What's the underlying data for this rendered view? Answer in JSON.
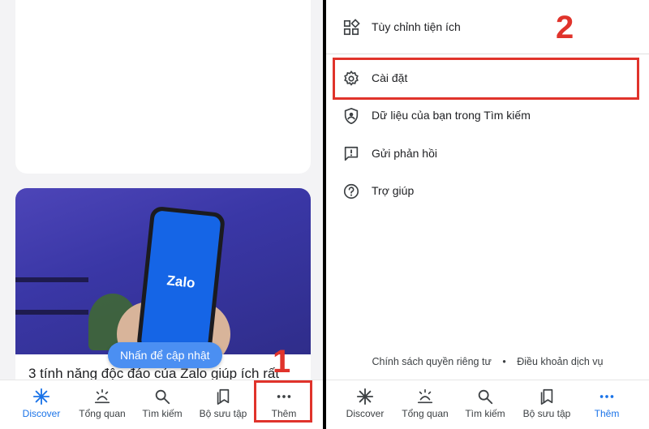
{
  "left": {
    "update_button": "Nhấn để cập nhật",
    "article_title": "3 tính năng độc đáo của Zalo giúp ích rất",
    "phone_brand": "Zalo",
    "step_label": "1"
  },
  "nav": {
    "items": [
      {
        "label": "Discover",
        "icon": "discover-icon",
        "active": true
      },
      {
        "label": "Tổng quan",
        "icon": "overview-icon"
      },
      {
        "label": "Tìm kiếm",
        "icon": "search-icon"
      },
      {
        "label": "Bộ sưu tập",
        "icon": "collections-icon"
      },
      {
        "label": "Thêm",
        "icon": "more-icon"
      }
    ]
  },
  "right": {
    "step_label": "2",
    "menu": [
      {
        "label": "Tùy chỉnh tiện ích",
        "icon": "widgets-icon"
      },
      {
        "label": "Cài đặt",
        "icon": "settings-icon"
      },
      {
        "label": "Dữ liệu của bạn trong Tìm kiếm",
        "icon": "shield-account-icon"
      },
      {
        "label": "Gửi phản hồi",
        "icon": "feedback-icon"
      },
      {
        "label": "Trợ giúp",
        "icon": "help-icon"
      }
    ],
    "footer": {
      "privacy": "Chính sách quyền riêng tư",
      "separator": "•",
      "terms": "Điều khoản dịch vụ"
    }
  },
  "colors": {
    "accent": "#1a73e8",
    "highlight": "#e0332b",
    "update_pill": "#4b8ff2"
  }
}
